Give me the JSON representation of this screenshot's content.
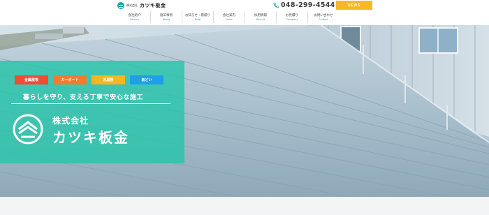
{
  "brand": {
    "small": "株式会社",
    "name": "カツキ板金"
  },
  "nav": {
    "items": [
      {
        "jp": "会社紹介",
        "en": "Service"
      },
      {
        "jp": "施工事例",
        "en": "Works"
      },
      {
        "jp": "お知らせ・雨漏り",
        "en": "Blog"
      },
      {
        "jp": "会社案内",
        "en": "Voice"
      },
      {
        "jp": "採用情報",
        "en": "Recruit"
      },
      {
        "jp": "お見積り",
        "en": "Company"
      },
      {
        "jp": "お問い合わせ",
        "en": "Contact"
      }
    ]
  },
  "contact": {
    "phone": "048-299-4544",
    "phone_icon": "phone-icon"
  },
  "news_button": "NEWS",
  "hero": {
    "tags": [
      "金属屋根",
      "カーポート",
      "瓦屋根",
      "雨どい"
    ],
    "tagline": "暮らしを守り、支える丁寧で安心な施工",
    "company_small": "株式会社",
    "company_name": "カツキ板金"
  },
  "colors": {
    "accent": "#17a7a7",
    "panel": "#26c4aa",
    "news": "#f6b925",
    "tag_red": "#ef4b37",
    "tag_orange": "#f47b2c",
    "tag_yellow": "#f4b623",
    "tag_blue": "#1fa0e6"
  }
}
